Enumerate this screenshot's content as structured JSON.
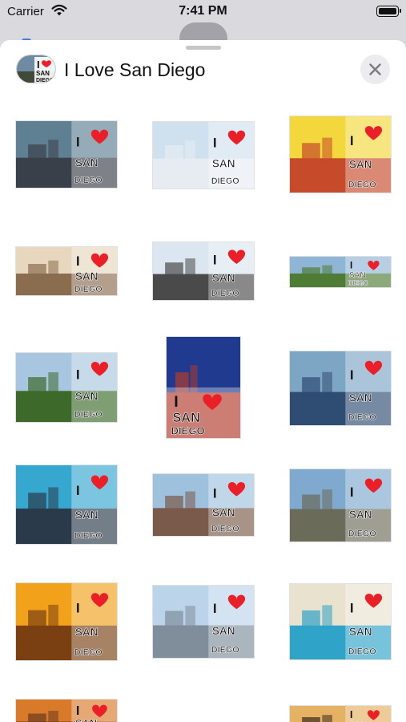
{
  "status_bar": {
    "carrier": "Carrier",
    "time": "7:41 PM"
  },
  "header": {
    "title": "I Love San Diego"
  },
  "sticker_text": {
    "line1": "I",
    "line2": "SAN",
    "line3": "DIEGO"
  },
  "colors": {
    "heart": "#ea1f27",
    "sheet_bg": "#ffffff",
    "dim_bg": "#d9d9de"
  },
  "icons": [
    "wifi-icon",
    "battery-icon",
    "close-icon",
    "heart-icon"
  ],
  "stickers": [
    {
      "name": "sticker-aerial-city",
      "sky": "#5f7f93",
      "ground": "#394049"
    },
    {
      "name": "sticker-paraglider-beach",
      "sky": "#cfe0ef",
      "ground": "#e6ecf2"
    },
    {
      "name": "sticker-seaport-village",
      "sky": "#f3d73c",
      "ground": "#c64b2a"
    },
    {
      "name": "sticker-pier-sunset",
      "sky": "#e7d7bf",
      "ground": "#8a6c4f"
    },
    {
      "name": "sticker-star-of-india",
      "sky": "#dbe6f0",
      "ground": "#4a4a4a"
    },
    {
      "name": "sticker-park-panorama",
      "sky": "#8fb6d7",
      "ground": "#4f7c35"
    },
    {
      "name": "sticker-mission-church",
      "sky": "#a8c6df",
      "ground": "#3d6a2a"
    },
    {
      "name": "sticker-convention-center",
      "sky": "#203a8f",
      "ground": "#b33a2a"
    },
    {
      "name": "sticker-coronado-bridge",
      "sky": "#7da6c5",
      "ground": "#2f4c73"
    },
    {
      "name": "sticker-harbor-aerial",
      "sky": "#36a7cf",
      "ground": "#2a3a4a"
    },
    {
      "name": "sticker-gaslamp-quarter",
      "sky": "#9ec2de",
      "ground": "#7a5a4a"
    },
    {
      "name": "sticker-la-jolla-cove",
      "sky": "#7fa9cf",
      "ground": "#6b6b5a"
    },
    {
      "name": "sticker-orange-sunset",
      "sky": "#f2a11a",
      "ground": "#7a4012"
    },
    {
      "name": "sticker-balboa-palm",
      "sky": "#bcd4ea",
      "ground": "#7f8e9a"
    },
    {
      "name": "sticker-seaworld-lagoon",
      "sky": "#e8e2cf",
      "ground": "#2fa3c8"
    },
    {
      "name": "sticker-market-tent",
      "sky": "#d97a2a",
      "ground": "#6b3b1f"
    },
    {
      "name": "sticker-sunset-pier",
      "sky": "#e5b163",
      "ground": "#3c2b1f"
    }
  ]
}
